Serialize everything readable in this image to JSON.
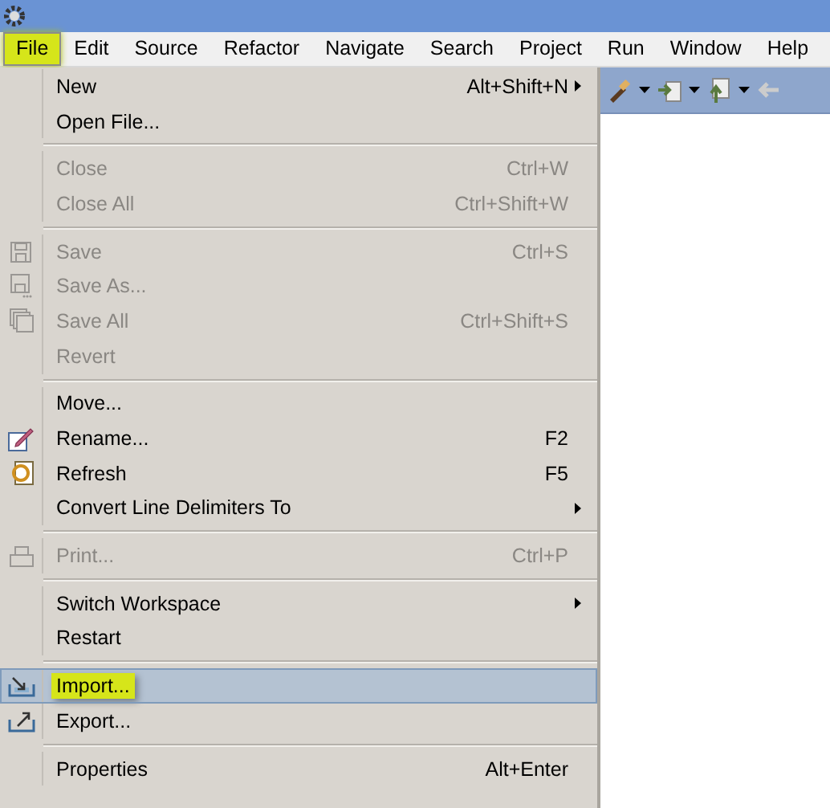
{
  "menu_bar": [
    {
      "label": "File",
      "selected": true,
      "annotated": true
    },
    {
      "label": "Edit",
      "selected": false,
      "annotated": false
    },
    {
      "label": "Source",
      "selected": false,
      "annotated": false
    },
    {
      "label": "Refactor",
      "selected": false,
      "annotated": false
    },
    {
      "label": "Navigate",
      "selected": false,
      "annotated": false
    },
    {
      "label": "Search",
      "selected": false,
      "annotated": false
    },
    {
      "label": "Project",
      "selected": false,
      "annotated": false
    },
    {
      "label": "Run",
      "selected": false,
      "annotated": false
    },
    {
      "label": "Window",
      "selected": false,
      "annotated": false
    },
    {
      "label": "Help",
      "selected": false,
      "annotated": false
    }
  ],
  "file_menu": [
    {
      "kind": "item",
      "label": "New",
      "shortcut": "Alt+Shift+N",
      "submenu": true,
      "disabled": false,
      "selected": false,
      "annotated": false
    },
    {
      "kind": "item",
      "label": "Open File...",
      "disabled": false,
      "selected": false,
      "annotated": false
    },
    {
      "kind": "separator"
    },
    {
      "kind": "item",
      "label": "Close",
      "shortcut": "Ctrl+W",
      "disabled": true,
      "selected": false,
      "annotated": false
    },
    {
      "kind": "item",
      "label": "Close All",
      "shortcut": "Ctrl+Shift+W",
      "disabled": true,
      "selected": false,
      "annotated": false
    },
    {
      "kind": "separator"
    },
    {
      "kind": "item",
      "label": "Save",
      "shortcut": "Ctrl+S",
      "disabled": true,
      "selected": false,
      "annotated": false
    },
    {
      "kind": "item",
      "label": "Save As...",
      "disabled": true,
      "selected": false,
      "annotated": false
    },
    {
      "kind": "item",
      "label": "Save All",
      "shortcut": "Ctrl+Shift+S",
      "disabled": true,
      "selected": false,
      "annotated": false
    },
    {
      "kind": "item",
      "label": "Revert",
      "disabled": true,
      "selected": false,
      "annotated": false
    },
    {
      "kind": "separator"
    },
    {
      "kind": "item",
      "label": "Move...",
      "disabled": false,
      "selected": false,
      "annotated": false
    },
    {
      "kind": "item",
      "label": "Rename...",
      "shortcut": "F2",
      "disabled": false,
      "selected": false,
      "annotated": false
    },
    {
      "kind": "item",
      "label": "Refresh",
      "shortcut": "F5",
      "disabled": false,
      "selected": false,
      "annotated": false
    },
    {
      "kind": "item",
      "label": "Convert Line Delimiters To",
      "submenu": true,
      "disabled": false,
      "selected": false,
      "annotated": false
    },
    {
      "kind": "separator"
    },
    {
      "kind": "item",
      "label": "Print...",
      "shortcut": "Ctrl+P",
      "disabled": true,
      "selected": false,
      "annotated": false
    },
    {
      "kind": "separator"
    },
    {
      "kind": "item",
      "label": "Switch Workspace",
      "submenu": true,
      "disabled": false,
      "selected": false,
      "annotated": false
    },
    {
      "kind": "item",
      "label": "Restart",
      "disabled": false,
      "selected": false,
      "annotated": false
    },
    {
      "kind": "separator"
    },
    {
      "kind": "item",
      "label": "Import...",
      "disabled": false,
      "selected": true,
      "annotated": true
    },
    {
      "kind": "item",
      "label": "Export...",
      "disabled": false,
      "selected": false,
      "annotated": false
    },
    {
      "kind": "separator"
    },
    {
      "kind": "item",
      "label": "Properties",
      "shortcut": "Alt+Enter",
      "disabled": false,
      "selected": false,
      "annotated": false
    }
  ]
}
